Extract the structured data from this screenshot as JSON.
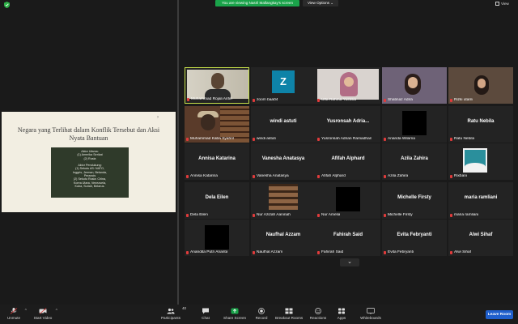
{
  "topbar": {
    "banner": "You are viewing Nasril Mallangkay's screen",
    "view_options": "View Options ⌄",
    "view": "View"
  },
  "slide": {
    "title": "Negara yang Terlihat dalam Konflik Tersebut dan Aksi Nyata Bantuan",
    "arrow": "›",
    "lines": [
      "Aktor Utama:",
      "(1) Amerika Serikat",
      "(2) Rusia",
      "",
      "Aktor Pendukung:",
      "(1) Sekutu AS: NATO,",
      "Inggris, Jerman, Belanda,",
      "Perancis",
      "(2) Sekutu Rusia: China,",
      "Korea Utara, Venezuela,",
      "Kuba, Suriah, Belarus."
    ]
  },
  "participants": [
    {
      "name": "Muhammad Rojali Arifin",
      "label": "",
      "kind": "face"
    },
    {
      "name": "zoom baa04",
      "label": "",
      "kind": "z"
    },
    {
      "name": "Ulfa Rahma Yustisia",
      "label": "",
      "kind": "hijab"
    },
    {
      "name": "Shatinaz Adira",
      "label": "",
      "kind": "shatinaz"
    },
    {
      "name": "Rizki utami",
      "label": "",
      "kind": "rizki"
    },
    {
      "name": "Muhammad Kaba Syahril",
      "label": "",
      "kind": "kaba"
    },
    {
      "name": "windi astuti",
      "label": "windi astuti",
      "kind": "text"
    },
    {
      "name": "Yusronsah Adrian Ramadhan",
      "label": "Yusronsah  Adria...",
      "kind": "text"
    },
    {
      "name": "Ananda Wilama",
      "label": "",
      "kind": "black"
    },
    {
      "name": "Ratu Nebila",
      "label": "Ratu Nebila",
      "kind": "text"
    },
    {
      "name": "Annisa Katarina",
      "label": "Annisa Katarina",
      "kind": "text"
    },
    {
      "name": "Vanesha Anatasya",
      "label": "Vanesha Anatasya",
      "kind": "text"
    },
    {
      "name": "Afifah Alphard",
      "label": "Afifah Alphard",
      "kind": "text"
    },
    {
      "name": "Azila Zahira",
      "label": "Azila Zahira",
      "kind": "text"
    },
    {
      "name": "Rixbani",
      "label": "",
      "kind": "rixbani"
    },
    {
      "name": "Dela Eilen",
      "label": "Dela Eilen",
      "kind": "text"
    },
    {
      "name": "Nur Azizah Aaninah",
      "label": "",
      "kind": "books"
    },
    {
      "name": "Nur Amelia",
      "label": "",
      "kind": "black"
    },
    {
      "name": "Michelle Firsty",
      "label": "Michelle Firsty",
      "kind": "text"
    },
    {
      "name": "maria ramliani",
      "label": "maria ramliani",
      "kind": "text"
    },
    {
      "name": "Anandita Putri Ananta",
      "label": "",
      "kind": "black"
    },
    {
      "name": "Naufhal Azzam",
      "label": "Naufhal Azzam",
      "kind": "text"
    },
    {
      "name": "Fahirah Said",
      "label": "Fahirah Said",
      "kind": "text"
    },
    {
      "name": "Evita Febryanti",
      "label": "Evita Febryanti",
      "kind": "text"
    },
    {
      "name": "Alwi Sihaf",
      "label": "Alwi Sihaf",
      "kind": "text"
    }
  ],
  "toolbar": {
    "unmute": "Unmute",
    "start_video": "Start Video",
    "participants": "Participants",
    "participants_count": "40",
    "chat": "Chat",
    "share_screen": "Share Screen",
    "record": "Record",
    "breakout_rooms": "Breakout Rooms",
    "reactions": "Reactions",
    "apps": "Apps",
    "whiteboards": "Whiteboards",
    "leave": "Leave Room"
  },
  "colors": {
    "active_speaker": "#c7e04a",
    "share_green": "#1aa34a",
    "leave_blue": "#1f5fcc",
    "muted_red": "#e03b3b"
  }
}
